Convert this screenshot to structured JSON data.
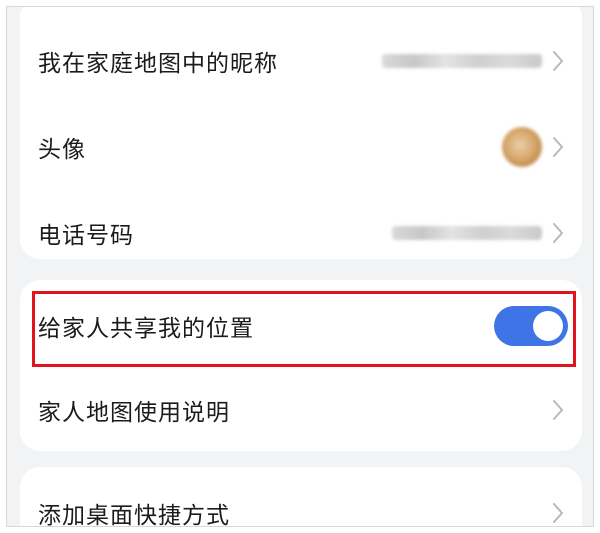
{
  "profile": {
    "nickname_label": "我在家庭地图中的昵称",
    "avatar_label": "头像",
    "phone_label": "电话号码"
  },
  "sharing": {
    "share_location_label": "给家人共享我的位置",
    "share_location_enabled": true,
    "map_help_label": "家人地图使用说明"
  },
  "shortcut": {
    "add_desktop_shortcut_label": "添加桌面快捷方式"
  },
  "colors": {
    "toggle_on": "#3f74e6",
    "highlight_border": "#e0141e",
    "background": "#f1f3f5"
  }
}
